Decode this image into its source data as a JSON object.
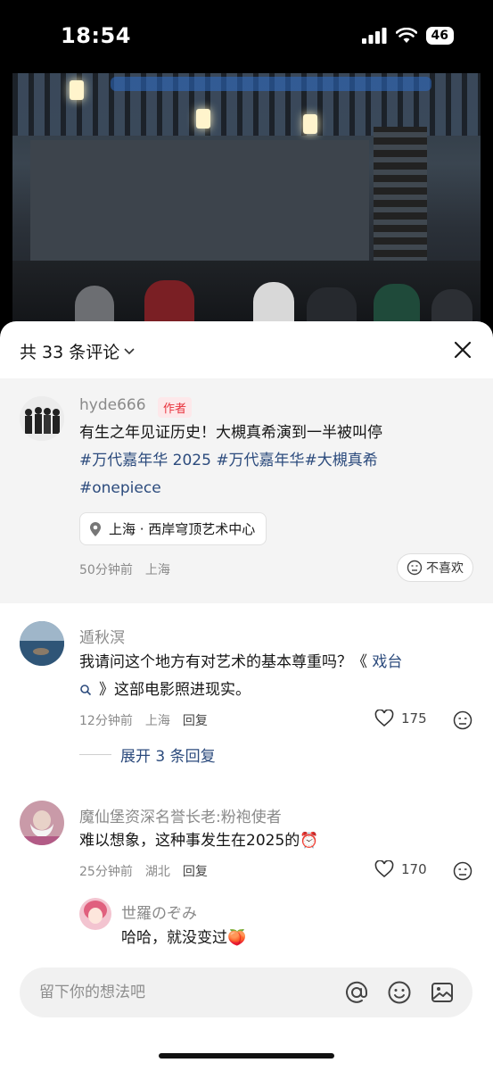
{
  "status_bar": {
    "time": "18:54",
    "battery": "46"
  },
  "sheet": {
    "title": "共 33 条评论",
    "author_comment": {
      "username": "hyde666",
      "author_tag": "作者",
      "text": "有生之年见证历史！大槻真希演到一半被叫停",
      "hashtags_line1": "#万代嘉年华 2025 #万代嘉年华#大槻真希",
      "hashtags_line2": "#onepiece",
      "location_chip": "上海 · 西岸穹顶艺术中心",
      "time": "50分钟前",
      "region": "上海",
      "dislike_label": "不喜欢"
    },
    "comments": [
      {
        "username": "遁秋溟",
        "text_line1_a": "我请问这个地方有对艺术的基本尊重吗？《",
        "text_line1_link": "戏台",
        "text_line2": "》这部电影照进现实。",
        "time": "12分钟前",
        "region": "上海",
        "reply_label": "回复",
        "likes": "175",
        "expand_label": "展开 3 条回复"
      },
      {
        "username": "魔仙堡资深名誉长老:粉袍使者",
        "text": "难以想象，这种事发生在2025的⏰",
        "time": "25分钟前",
        "region": "湖北",
        "reply_label": "回复",
        "likes": "170"
      }
    ],
    "reply": {
      "username": "世羅のぞみ",
      "text": "哈哈，就没变过🍑"
    },
    "input_placeholder": "留下你的想法吧"
  }
}
